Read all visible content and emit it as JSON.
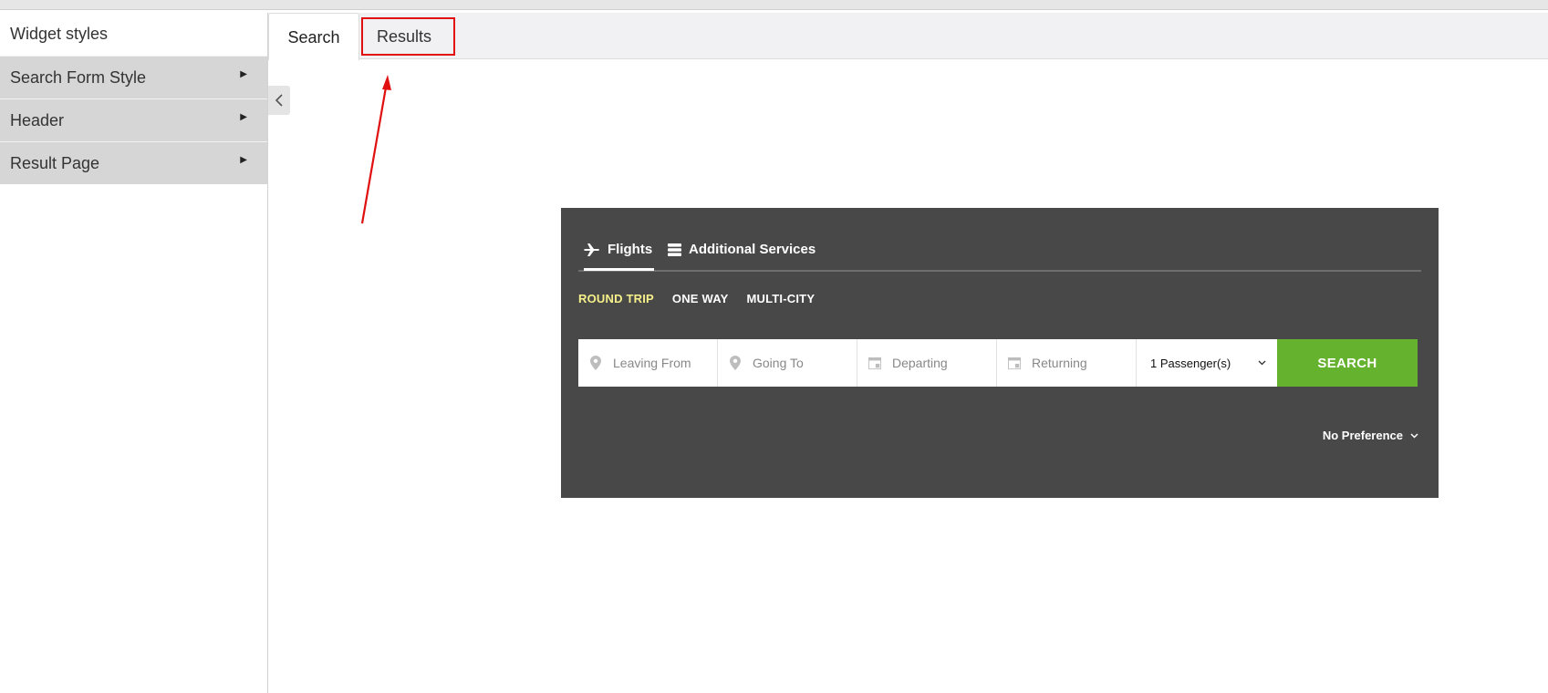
{
  "sidebar": {
    "title": "Widget styles",
    "items": [
      {
        "label": "Search Form Style"
      },
      {
        "label": "Header"
      },
      {
        "label": "Result Page"
      }
    ]
  },
  "tabs": [
    {
      "label": "Search",
      "active": true
    },
    {
      "label": "Results",
      "active": false
    }
  ],
  "widget": {
    "modes": [
      {
        "label": "Flights",
        "icon": "plane-icon",
        "active": true
      },
      {
        "label": "Additional Services",
        "icon": "services-icon",
        "active": false
      }
    ],
    "trip_types": [
      {
        "label": "ROUND TRIP",
        "active": true
      },
      {
        "label": "ONE WAY",
        "active": false
      },
      {
        "label": "MULTI-CITY",
        "active": false
      }
    ],
    "fields": {
      "leaving_placeholder": "Leaving From",
      "going_placeholder": "Going To",
      "departing_placeholder": "Departing",
      "returning_placeholder": "Returning"
    },
    "passengers": "1 Passenger(s)",
    "search_label": "SEARCH",
    "preference": "No Preference"
  },
  "colors": {
    "widget_bg": "#484848",
    "search_button": "#64b22d",
    "active_trip": "#f5f08a",
    "highlight": "#e01010"
  }
}
